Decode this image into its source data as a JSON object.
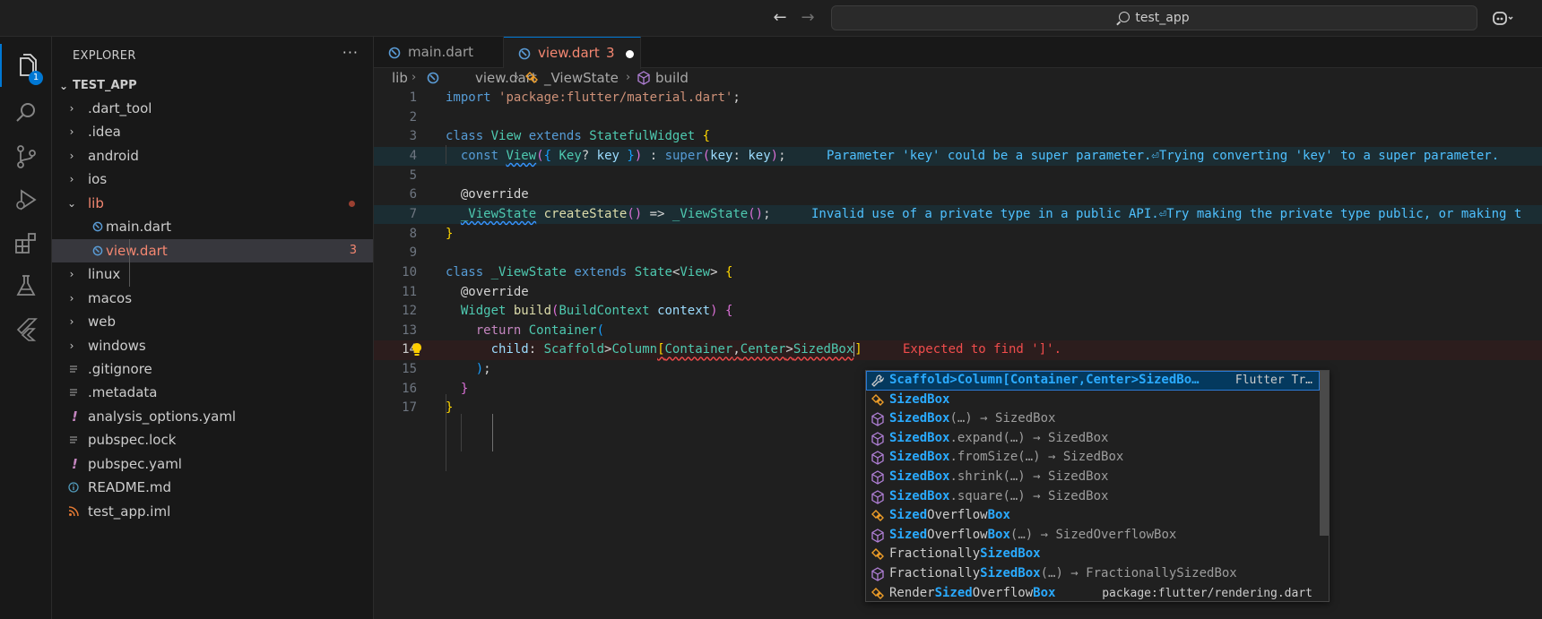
{
  "titlebar": {
    "search_text": "test_app"
  },
  "activity": {
    "explorer_badge": "1"
  },
  "explorer": {
    "header": "EXPLORER",
    "more": "···",
    "root": "TEST_APP",
    "items": [
      {
        "label": ".dart_tool",
        "type": "folder"
      },
      {
        "label": ".idea",
        "type": "folder"
      },
      {
        "label": "android",
        "type": "folder"
      },
      {
        "label": "ios",
        "type": "folder"
      },
      {
        "label": "lib",
        "type": "folder-open"
      },
      {
        "label": "main.dart",
        "type": "dart"
      },
      {
        "label": "view.dart",
        "type": "dart",
        "problems": "3"
      },
      {
        "label": "linux",
        "type": "folder"
      },
      {
        "label": "macos",
        "type": "folder"
      },
      {
        "label": "web",
        "type": "folder"
      },
      {
        "label": "windows",
        "type": "folder"
      },
      {
        "label": ".gitignore",
        "type": "file"
      },
      {
        "label": ".metadata",
        "type": "file"
      },
      {
        "label": "analysis_options.yaml",
        "type": "yaml"
      },
      {
        "label": "pubspec.lock",
        "type": "file"
      },
      {
        "label": "pubspec.yaml",
        "type": "yaml"
      },
      {
        "label": "README.md",
        "type": "info"
      },
      {
        "label": "test_app.iml",
        "type": "rss"
      }
    ]
  },
  "tabs": [
    {
      "label": "main.dart"
    },
    {
      "label": "view.dart",
      "problems": "3"
    }
  ],
  "breadcrumbs": {
    "folder": "lib",
    "file": "view.dart",
    "class": "_ViewState",
    "method": "build"
  },
  "editor": {
    "line_numbers": [
      "1",
      "2",
      "3",
      "4",
      "5",
      "6",
      "7",
      "8",
      "9",
      "10",
      "11",
      "12",
      "13",
      "14",
      "15",
      "16",
      "17"
    ],
    "current_line": "14",
    "diagnostics": {
      "line4": "Parameter 'key' could be a super parameter.⏎Trying converting 'key' to a super parameter.",
      "line7": "Invalid use of a private type in a public API.⏎Try making the private type public, or making t",
      "line14": "Expected to find ']'."
    }
  },
  "suggest": {
    "items": [
      {
        "hl": "Scaffold>Column[Container,Center>SizedBo…",
        "rest": "",
        "detail": "Flutter Tr…",
        "icon": "snippet"
      },
      {
        "hl": "SizedBox",
        "rest": "",
        "detail": "",
        "icon": "class"
      },
      {
        "hl": "SizedBox",
        "rest": "(…) → SizedBox",
        "detail": "",
        "icon": "ctor"
      },
      {
        "hl": "SizedBox",
        "rest": ".expand(…) → SizedBox",
        "detail": "",
        "icon": "ctor"
      },
      {
        "hl": "SizedBox",
        "rest": ".fromSize(…) → SizedBox",
        "detail": "",
        "icon": "ctor"
      },
      {
        "hl": "SizedBox",
        "rest": ".shrink(…) → SizedBox",
        "detail": "",
        "icon": "ctor"
      },
      {
        "hl": "SizedBox",
        "rest": ".square(…) → SizedBox",
        "detail": "",
        "icon": "ctor"
      },
      {
        "pre": "",
        "hl": "Sized",
        "mid": "Overflow",
        "hl2": "Box",
        "rest": "",
        "detail": "",
        "icon": "class"
      },
      {
        "pre": "",
        "hl": "Sized",
        "mid": "Overflow",
        "hl2": "Box",
        "rest": "(…) → SizedOverflowBox",
        "detail": "",
        "icon": "ctor"
      },
      {
        "pre": "Fractionally",
        "hl": "SizedBox",
        "rest": "",
        "detail": "",
        "icon": "class"
      },
      {
        "pre": "Fractionally",
        "hl": "SizedBox",
        "rest": "(…) → FractionallySizedBox",
        "detail": "",
        "icon": "ctor"
      },
      {
        "pre": "Render",
        "hl": "Sized",
        "mid": "Overflow",
        "hl2": "Box",
        "rest": "",
        "detail": "package:flutter/rendering.dart",
        "icon": "class"
      }
    ]
  },
  "colors": {
    "accent": "#0078d4",
    "error": "#f48771",
    "info": "#3794ff"
  }
}
